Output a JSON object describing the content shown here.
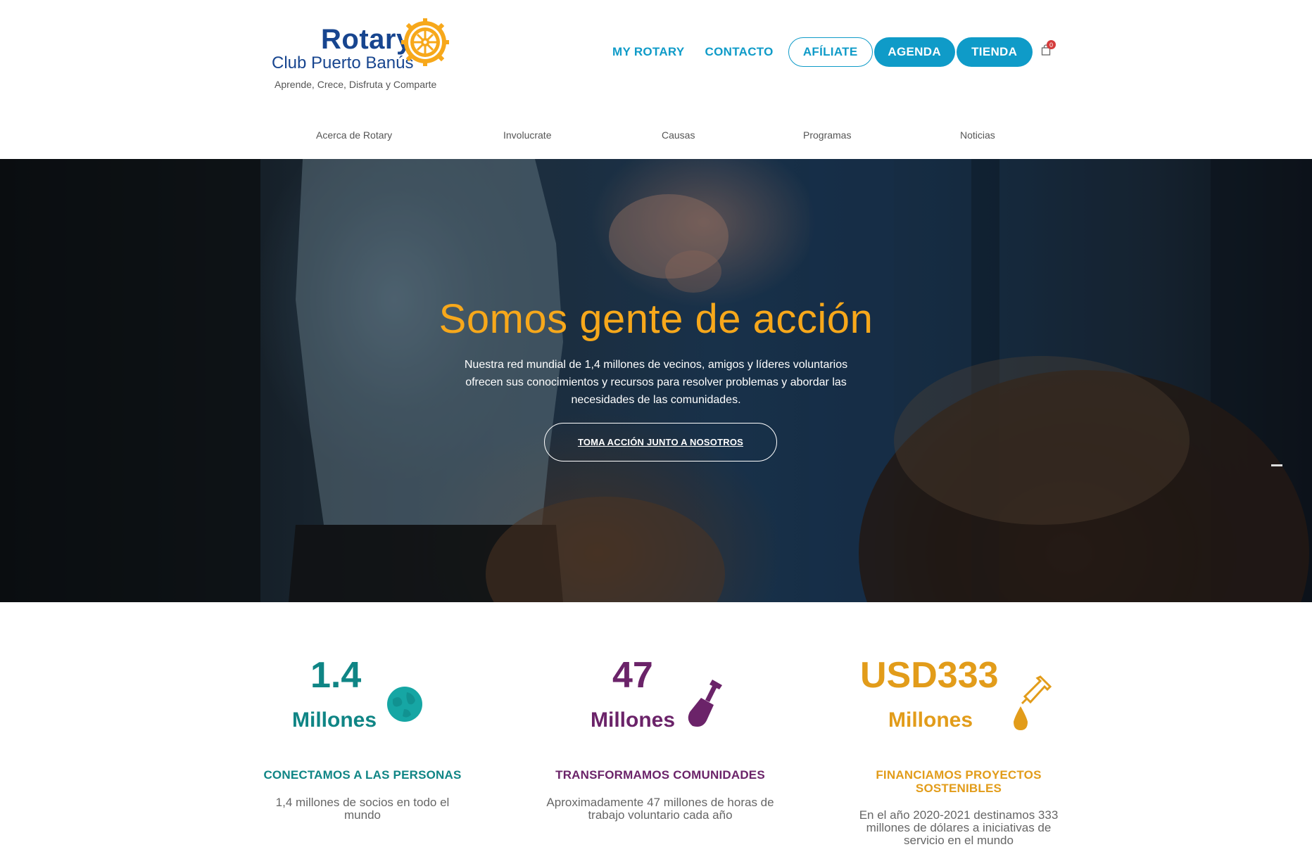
{
  "brand": {
    "name": "Rotary",
    "club": "Club Puerto Banús",
    "tagline": "Aprende, Crece, Disfruta y Comparte"
  },
  "topnav": {
    "my_rotary": "MY ROTARY",
    "contacto": "CONTACTO",
    "afiliate": "AFÍLIATE",
    "agenda": "AGENDA",
    "tienda": "TIENDA",
    "cart_count": "0"
  },
  "subnav": {
    "items": [
      "Acerca de Rotary",
      "Involucrate",
      "Causas",
      "Programas",
      "Noticias"
    ]
  },
  "hero": {
    "title": "Somos gente de acción",
    "text": "Nuestra red mundial de 1,4 millones de vecinos, amigos y líderes voluntarios ofrecen sus conocimientos y recursos para resolver problemas y abordar las necesidades de las comunidades.",
    "cta": "TOMA ACCIÓN JUNTO A NOSOTROS"
  },
  "stats": [
    {
      "number": "1.4",
      "unit": "Millones",
      "heading": "CONECTAMOS A LAS PERSONAS",
      "description": "1,4 millones de socios en todo el mundo",
      "icon": "globe-icon",
      "color": "#0f8585"
    },
    {
      "number": "47",
      "unit": "Millones",
      "heading": "TRANSFORMAMOS COMUNIDADES",
      "description": "Aproximadamente 47 millones de horas de trabajo voluntario cada año",
      "icon": "shovel-icon",
      "color": "#6b2369"
    },
    {
      "number": "USD333",
      "unit": "Millones",
      "heading": "FINANCIAMOS PROYECTOS SOSTENIBLES",
      "description": "En el año 2020-2021 destinamos 333 millones de dólares a iniciativas de servicio en el mundo",
      "icon": "dropper-icon",
      "color": "#e29c1a"
    }
  ],
  "colors": {
    "accent_blue": "#0f9bc8",
    "rotary_navy": "#17458f",
    "rotary_gold": "#f7a81b"
  }
}
